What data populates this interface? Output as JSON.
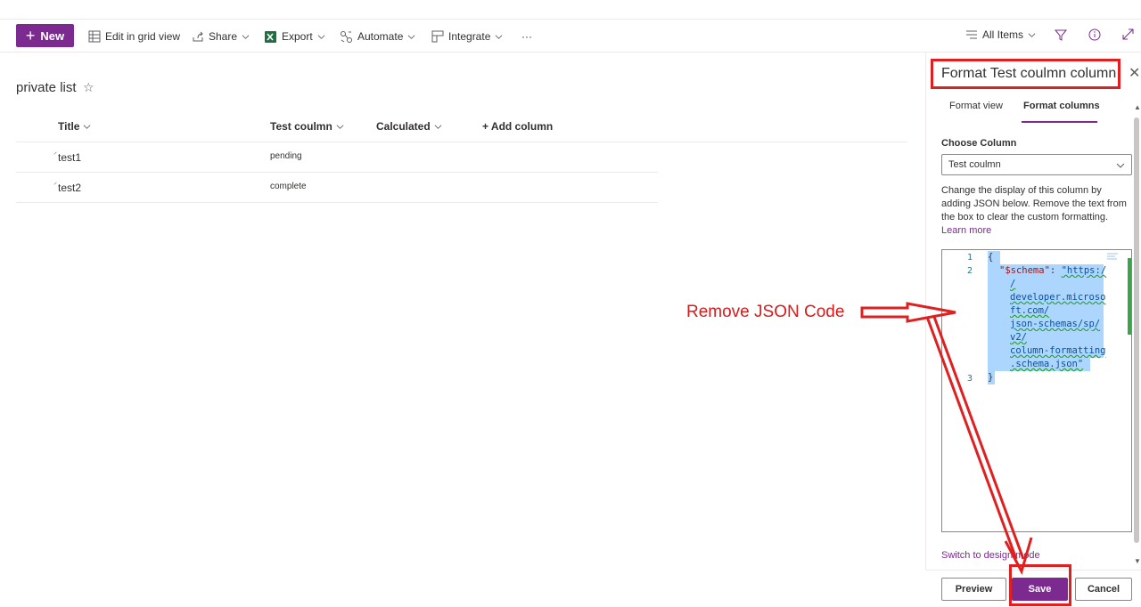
{
  "command_bar": {
    "new_label": "New",
    "edit_grid_label": "Edit in grid view",
    "share_label": "Share",
    "export_label": "Export",
    "automate_label": "Automate",
    "integrate_label": "Integrate",
    "more_label": "···",
    "view_label": "All Items"
  },
  "list": {
    "title": "private list",
    "star": "☆",
    "columns": [
      "Title",
      "Test coulmn",
      "Calculated"
    ],
    "add_column_label": "+ Add column",
    "rows": [
      {
        "title": "test1",
        "test_coulmn": "pending"
      },
      {
        "title": "test2",
        "test_coulmn": "complete"
      }
    ]
  },
  "panel": {
    "title": "Format Test coulmn column",
    "close": "✕",
    "tabs": [
      "Format view",
      "Format columns"
    ],
    "active_tab": "Format columns",
    "choose_label": "Choose Column",
    "choose_value": "Test coulmn",
    "help_text": "Change the display of this column by adding JSON below. Remove the text from the box to clear the custom formatting.",
    "learn_more": "Learn more",
    "editor": {
      "line_numbers": [
        "1",
        "2",
        "3"
      ],
      "open_brace": "{",
      "close_brace": "}",
      "key": "\"$schema\"",
      "colon": ":",
      "value_lines": [
        "\"https:/",
        "/",
        "developer.microso",
        "ft.com/",
        "json-schemas/sp/",
        "v2/",
        "column-formatting",
        ".schema.json\""
      ]
    },
    "switch_link": "Switch to design mode",
    "buttons": {
      "preview": "Preview",
      "save": "Save",
      "cancel": "Cancel"
    }
  },
  "annotation": {
    "text": "Remove JSON Code",
    "color": "#d81b1b"
  },
  "colors": {
    "accent": "#7c2a8f",
    "highlight_box": "#e02020"
  }
}
